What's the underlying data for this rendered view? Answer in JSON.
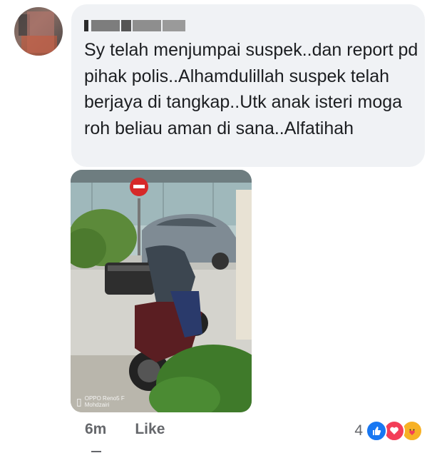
{
  "comment": {
    "text": "Sy telah menjumpai suspek..dan report pd pihak polis..Alhamdulillah suspek telah berjaya di tangkap..Utk anak isteri moga roh beliau aman di sana..Alfatihah"
  },
  "photo": {
    "watermark_line1": "OPPO Reno5 F",
    "watermark_line2": "Mohdzairi"
  },
  "actions": {
    "time": "6m",
    "like_label": "Like"
  },
  "reactions": {
    "count": "4",
    "types": [
      "like-icon",
      "love-icon",
      "care-icon"
    ],
    "colors": {
      "like": "#1877f2",
      "love": "#f33e58",
      "care": "#f7b125"
    }
  }
}
